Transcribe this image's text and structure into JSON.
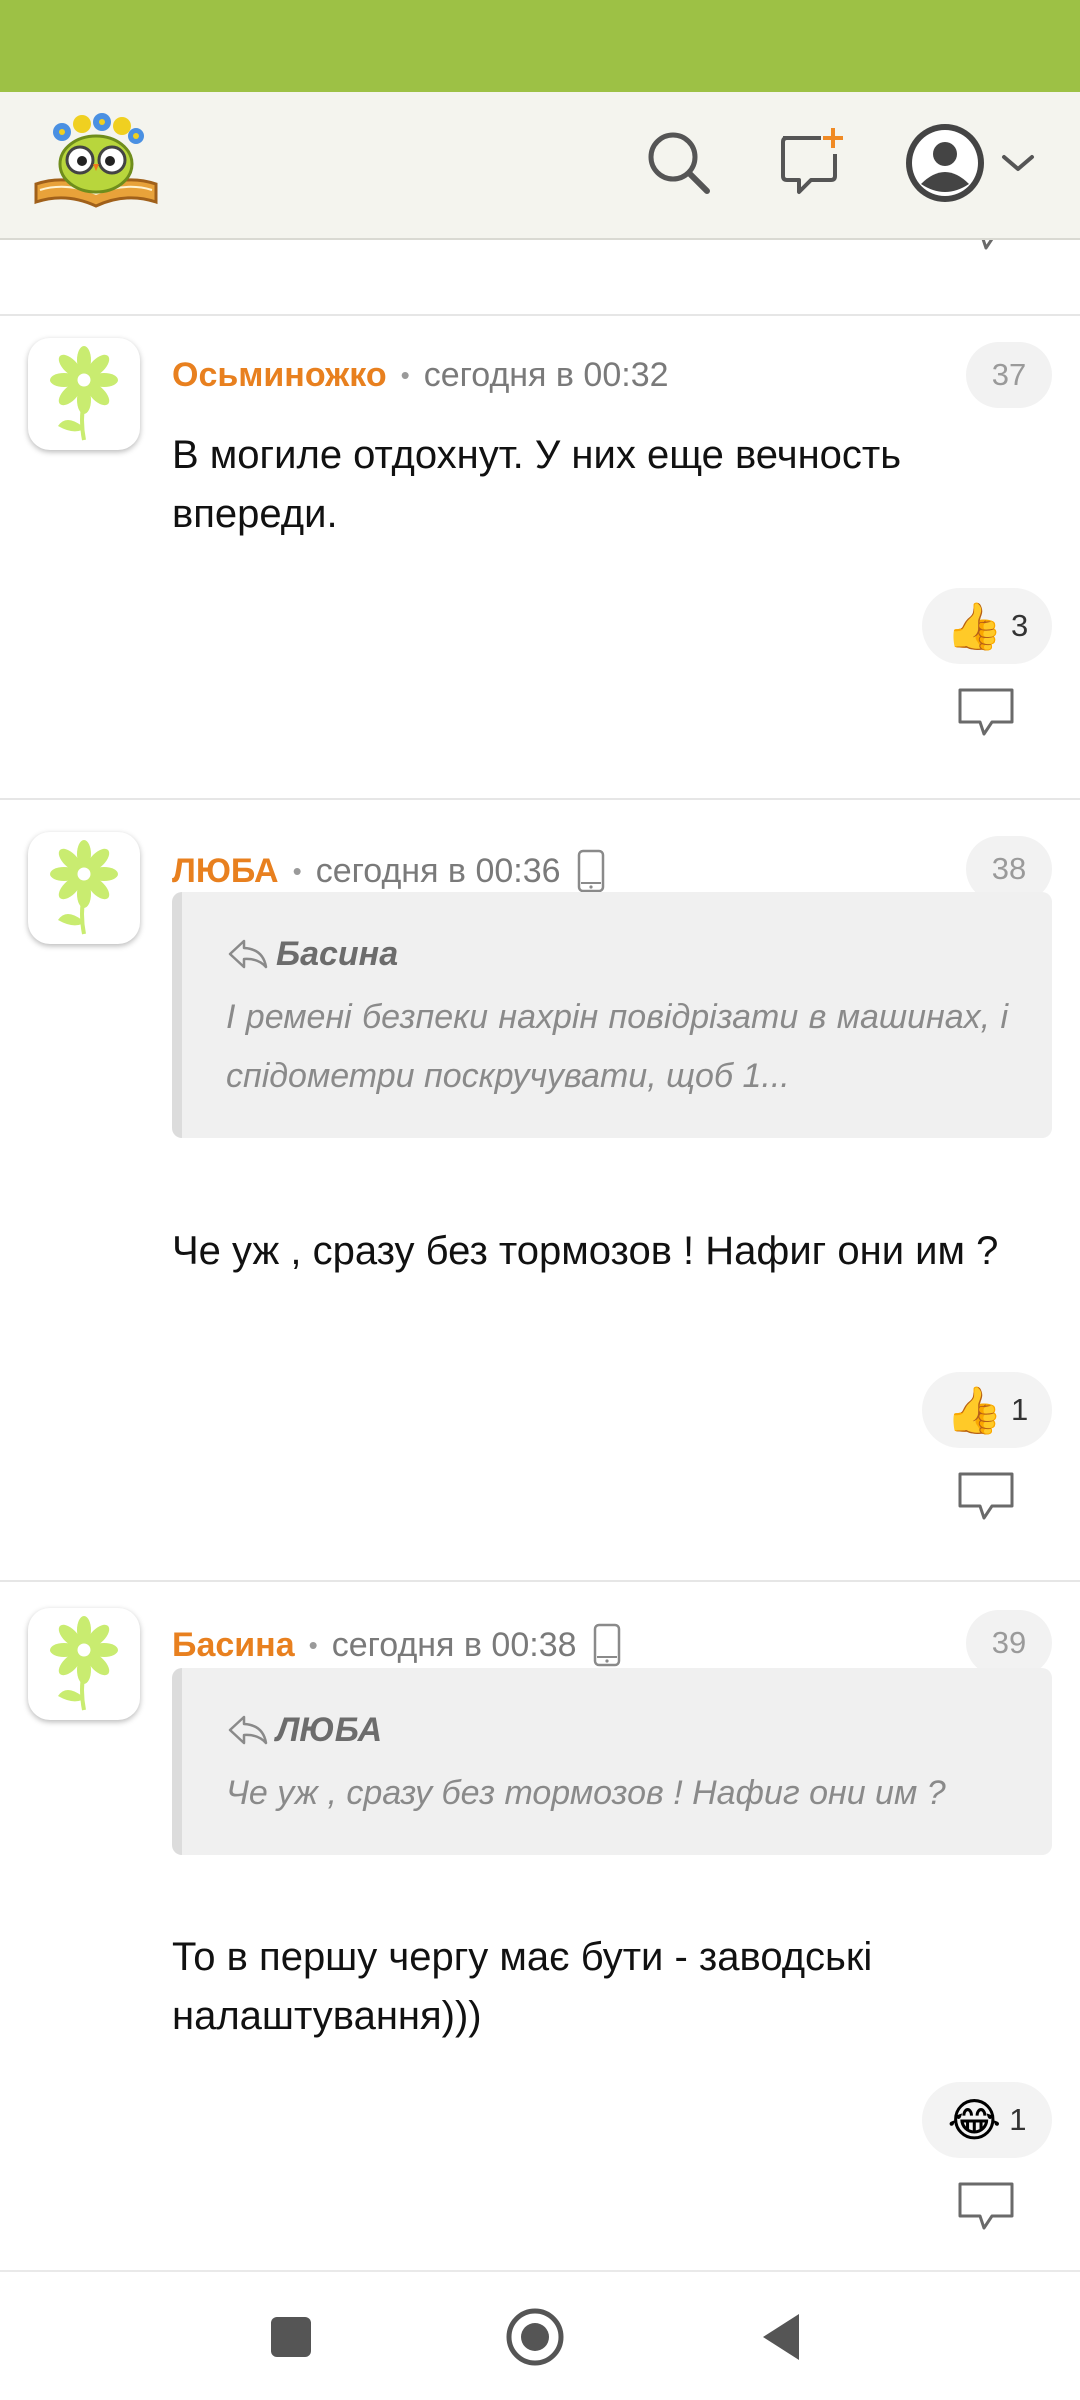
{
  "header": {
    "logo": "owl-with-flowers-book-logo",
    "icons": [
      "search-icon",
      "new-message-icon",
      "user-avatar-icon",
      "chevron-down-icon"
    ]
  },
  "colors": {
    "status_bar": "#9dc145",
    "header_bg": "#f4f4ee",
    "author": "#e8801f"
  },
  "comments": [
    {
      "author": "Осьминожко",
      "separator": "•",
      "time": "сегодня в 00:32",
      "number": "37",
      "text": "В могиле отдохнут. У них еще вечность впереди.",
      "reaction": {
        "emoji": "👍",
        "count": "3"
      }
    },
    {
      "author": "ЛЮБА",
      "separator": "•",
      "time": "сегодня в 00:36",
      "number": "38",
      "quote": {
        "author": "Басина",
        "text": "І ремені безпеки нахрін повідрізати в машинах, і спідометри поскручувати, щоб 1..."
      },
      "text": "Че уж , сразу без тормозов ! Нафиг они им ?",
      "reaction": {
        "emoji": "👍",
        "count": "1"
      }
    },
    {
      "author": "Басина",
      "separator": "•",
      "time": "сегодня в 00:38",
      "number": "39",
      "quote": {
        "author": "ЛЮБА",
        "text": "Че уж , сразу без тормозов ! Нафиг они им ?"
      },
      "text": "То в першу чергу має бути - заводські налаштування)))",
      "reaction": {
        "emoji": "😂",
        "count": "1"
      }
    }
  ],
  "navigation": [
    "recents-square-icon",
    "home-circle-icon",
    "back-triangle-icon"
  ]
}
